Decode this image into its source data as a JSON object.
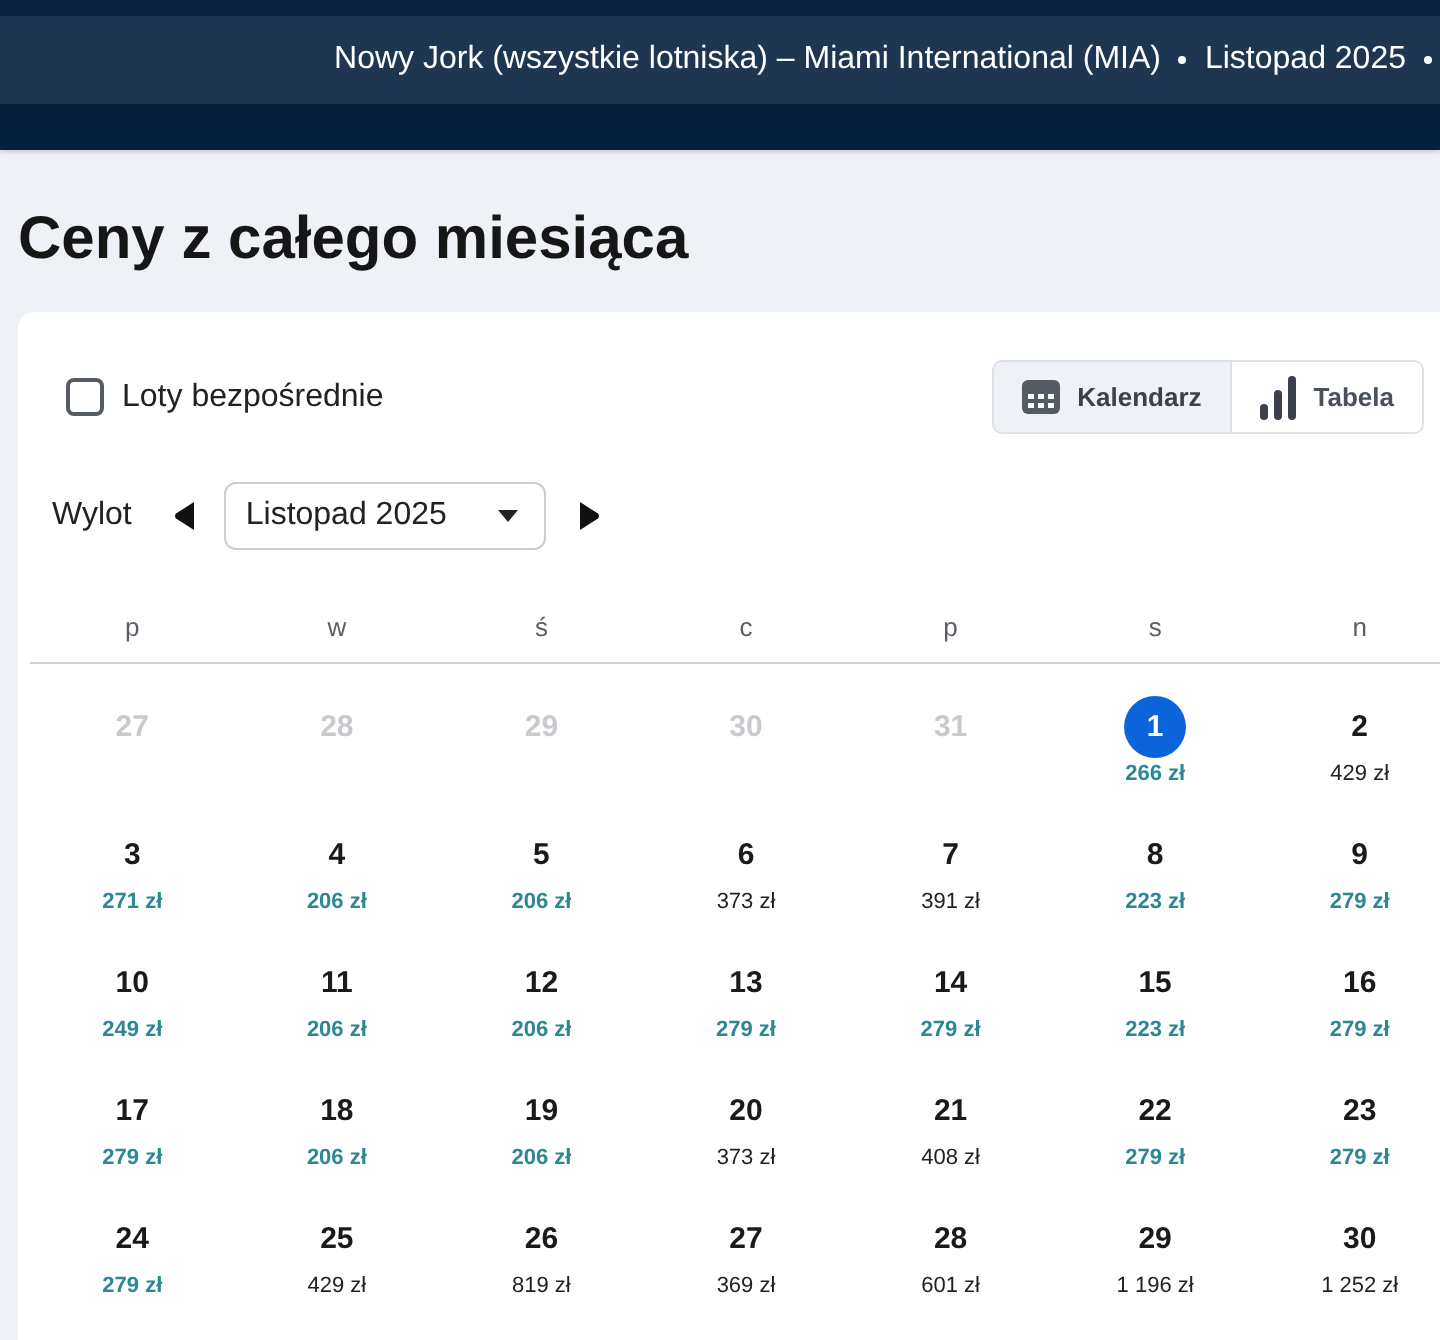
{
  "header": {
    "breadcrumb": [
      "Nowy Jork (wszystkie lotniska) – Miami International (MIA)",
      "Listopad 2025"
    ]
  },
  "page": {
    "title": "Ceny z całego miesiąca"
  },
  "filters": {
    "direct_flights": {
      "label": "Loty bezpośrednie",
      "checked": false
    }
  },
  "view_toggle": [
    {
      "label": "Kalendarz",
      "kind": "calendar",
      "selected": true
    },
    {
      "label": "Tabela",
      "kind": "chart",
      "selected": false
    }
  ],
  "departure": {
    "label": "Wylot",
    "month": "Listopad 2025"
  },
  "calendar": {
    "weekdays": [
      "p",
      "w",
      "ś",
      "c",
      "p",
      "s",
      "n"
    ],
    "weeks": [
      [
        {
          "day": "27",
          "outside": true,
          "selected": false
        },
        {
          "day": "28",
          "outside": true,
          "selected": false
        },
        {
          "day": "29",
          "outside": true,
          "selected": false
        },
        {
          "day": "30",
          "outside": true,
          "selected": false
        },
        {
          "day": "31",
          "outside": true,
          "selected": false
        },
        {
          "day": "1",
          "outside": false,
          "selected": true,
          "price": "266 zł",
          "cheap": true
        },
        {
          "day": "2",
          "outside": false,
          "selected": false,
          "price": "429 zł",
          "cheap": false
        }
      ],
      [
        {
          "day": "3",
          "outside": false,
          "selected": false,
          "price": "271 zł",
          "cheap": true
        },
        {
          "day": "4",
          "outside": false,
          "selected": false,
          "price": "206 zł",
          "cheap": true
        },
        {
          "day": "5",
          "outside": false,
          "selected": false,
          "price": "206 zł",
          "cheap": true
        },
        {
          "day": "6",
          "outside": false,
          "selected": false,
          "price": "373 zł",
          "cheap": false
        },
        {
          "day": "7",
          "outside": false,
          "selected": false,
          "price": "391 zł",
          "cheap": false
        },
        {
          "day": "8",
          "outside": false,
          "selected": false,
          "price": "223 zł",
          "cheap": true
        },
        {
          "day": "9",
          "outside": false,
          "selected": false,
          "price": "279 zł",
          "cheap": true
        }
      ],
      [
        {
          "day": "10",
          "outside": false,
          "selected": false,
          "price": "249 zł",
          "cheap": true
        },
        {
          "day": "11",
          "outside": false,
          "selected": false,
          "price": "206 zł",
          "cheap": true
        },
        {
          "day": "12",
          "outside": false,
          "selected": false,
          "price": "206 zł",
          "cheap": true
        },
        {
          "day": "13",
          "outside": false,
          "selected": false,
          "price": "279 zł",
          "cheap": true
        },
        {
          "day": "14",
          "outside": false,
          "selected": false,
          "price": "279 zł",
          "cheap": true
        },
        {
          "day": "15",
          "outside": false,
          "selected": false,
          "price": "223 zł",
          "cheap": true
        },
        {
          "day": "16",
          "outside": false,
          "selected": false,
          "price": "279 zł",
          "cheap": true
        }
      ],
      [
        {
          "day": "17",
          "outside": false,
          "selected": false,
          "price": "279 zł",
          "cheap": true
        },
        {
          "day": "18",
          "outside": false,
          "selected": false,
          "price": "206 zł",
          "cheap": true
        },
        {
          "day": "19",
          "outside": false,
          "selected": false,
          "price": "206 zł",
          "cheap": true
        },
        {
          "day": "20",
          "outside": false,
          "selected": false,
          "price": "373 zł",
          "cheap": false
        },
        {
          "day": "21",
          "outside": false,
          "selected": false,
          "price": "408 zł",
          "cheap": false
        },
        {
          "day": "22",
          "outside": false,
          "selected": false,
          "price": "279 zł",
          "cheap": true
        },
        {
          "day": "23",
          "outside": false,
          "selected": false,
          "price": "279 zł",
          "cheap": true
        }
      ],
      [
        {
          "day": "24",
          "outside": false,
          "selected": false,
          "price": "279 zł",
          "cheap": true
        },
        {
          "day": "25",
          "outside": false,
          "selected": false,
          "price": "429 zł",
          "cheap": false
        },
        {
          "day": "26",
          "outside": false,
          "selected": false,
          "price": "819 zł",
          "cheap": false
        },
        {
          "day": "27",
          "outside": false,
          "selected": false,
          "price": "369 zł",
          "cheap": false
        },
        {
          "day": "28",
          "outside": false,
          "selected": false,
          "price": "601 zł",
          "cheap": false
        },
        {
          "day": "29",
          "outside": false,
          "selected": false,
          "price": "1 196 zł",
          "cheap": false
        },
        {
          "day": "30",
          "outside": false,
          "selected": false,
          "price": "1 252 zł",
          "cheap": false
        }
      ]
    ]
  }
}
